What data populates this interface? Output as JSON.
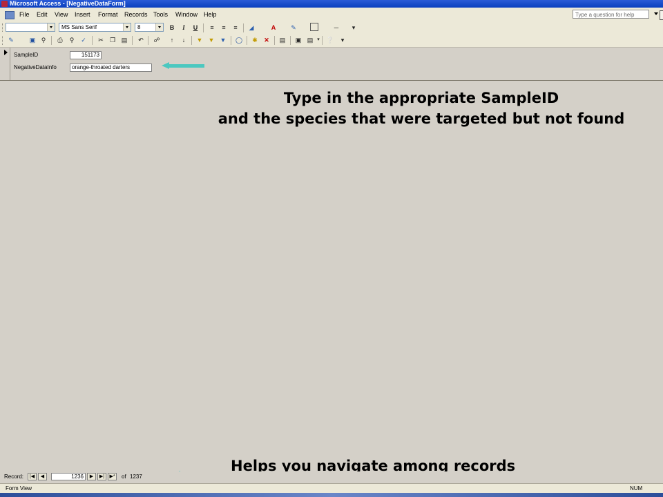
{
  "window": {
    "title": "Microsoft Access - [NegativeDataForm]"
  },
  "menu": {
    "items": [
      "File",
      "Edit",
      "View",
      "Insert",
      "Format",
      "Records",
      "Tools",
      "Window",
      "Help"
    ],
    "help_placeholder": "Type a question for help"
  },
  "toolbar": {
    "object_combo": "",
    "font_name": "MS Sans Serif",
    "font_size": "8",
    "bold": "B",
    "italic": "I",
    "underline": "U",
    "font_color_glyph": "A"
  },
  "form": {
    "fields": [
      {
        "label": "SampleID",
        "value": "151173"
      },
      {
        "label": "NegativeDataInfo",
        "value": "orange-throated darters"
      }
    ]
  },
  "annotations": {
    "instruction_line1": "Type in the appropriate SampleID",
    "instruction_line2": "and the species that were targeted but not found",
    "nav_hint": "Helps you navigate among records"
  },
  "navigation": {
    "label": "Record:",
    "current": "1236",
    "of_label": "of",
    "total": "1237"
  },
  "status": {
    "view": "Form View",
    "num": "NUM"
  },
  "colors": {
    "arrow": "#4bc8c0",
    "titlebar": "#0a3fbf",
    "form_background": "#d4d0c8"
  }
}
